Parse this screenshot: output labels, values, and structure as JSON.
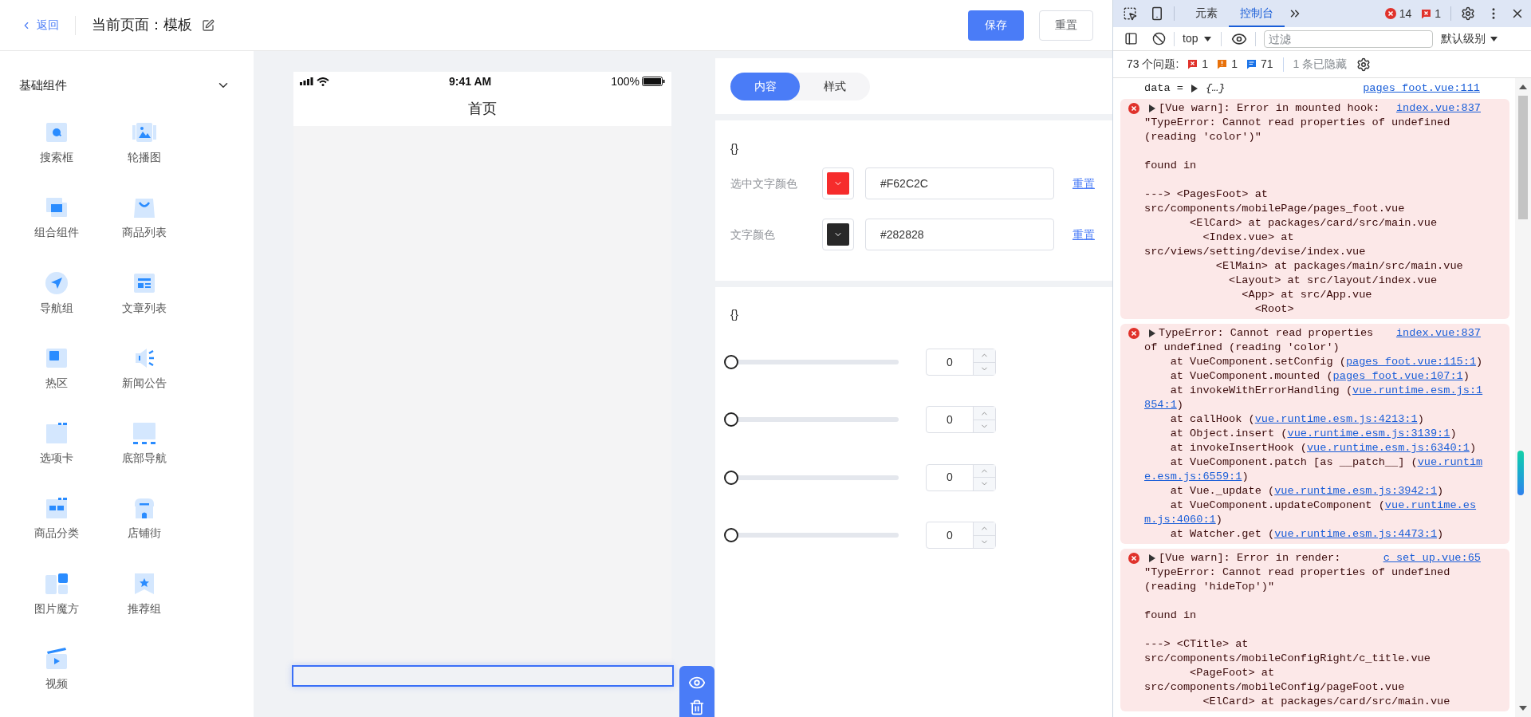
{
  "header": {
    "back": "返回",
    "title": "当前页面：模板",
    "save": "保存",
    "reset": "重置"
  },
  "sidebar": {
    "group": "基础组件",
    "expanded": true,
    "items": [
      "搜索框",
      "轮播图",
      "组合组件",
      "商品列表",
      "导航组",
      "文章列表",
      "热区",
      "新闻公告",
      "选项卡",
      "底部导航",
      "商品分类",
      "店铺街",
      "图片魔方",
      "推荐组",
      "视频"
    ]
  },
  "phone": {
    "time": "9:41 AM",
    "battery": "100%",
    "title": "首页"
  },
  "settings": {
    "tabs": [
      {
        "label": "内容",
        "selected": true
      },
      {
        "label": "样式",
        "selected": false
      }
    ],
    "color_card": {
      "title": "{}",
      "rows": [
        {
          "label": "选中文字颜色",
          "color": "#f62c2c",
          "value": "#F62C2C",
          "reset": "重置"
        },
        {
          "label": "文字颜色",
          "color": "#282828",
          "value": "#282828",
          "reset": "重置"
        }
      ]
    },
    "slider_card": {
      "title": "{}",
      "sliders": [
        {
          "level": 0,
          "value": "0"
        },
        {
          "level": 0,
          "value": "0"
        },
        {
          "level": 0,
          "value": "0"
        },
        {
          "level": 0,
          "value": "0"
        }
      ]
    }
  },
  "devtools": {
    "tabs": [
      {
        "label": "元素",
        "selected": false
      },
      {
        "label": "控制台",
        "selected": true
      }
    ],
    "error_count": "14",
    "issue_count": "1",
    "context": "top",
    "filter_placeholder": "过滤",
    "level": "默认级别",
    "issues_label": "73 个问题:",
    "issues": [
      {
        "kind": "error",
        "count": "1"
      },
      {
        "kind": "warning",
        "count": "1"
      },
      {
        "kind": "info",
        "count": "71"
      }
    ],
    "hidden": "1 条已隐藏",
    "console": [
      {
        "kind": "object",
        "name": "data =",
        "value": "{…}",
        "source": "pages_foot.vue:111"
      },
      {
        "kind": "error",
        "header": "[Vue warn]: Error in mounted hook:",
        "source": "index.vue:837",
        "paragraphs": [
          [
            {
              "text": "\"TypeError: Cannot read properties of undefined"
            },
            {
              "text": "(reading 'color')\""
            }
          ],
          [
            {
              "text": "found in"
            }
          ],
          [
            {
              "text": "---> <PagesFoot> at"
            },
            {
              "text": "src/components/mobilePage/pages_foot.vue"
            },
            {
              "text": "       <ElCard> at packages/card/src/main.vue"
            },
            {
              "text": "         <Index.vue> at"
            },
            {
              "text": "src/views/setting/devise/index.vue"
            },
            {
              "text": "           <ElMain> at packages/main/src/main.vue"
            },
            {
              "text": "             <Layout> at src/layout/index.vue"
            },
            {
              "text": "               <App> at src/App.vue"
            },
            {
              "text": "                 <Root>"
            }
          ]
        ]
      },
      {
        "kind": "error",
        "header": "TypeError: Cannot read properties",
        "source": "index.vue:837",
        "paragraphs": [
          [
            {
              "text": "of undefined (reading 'color')"
            },
            {
              "text": "    at VueComponent.setConfig (",
              "link": "pages_foot.vue:115:1",
              "after": ")"
            },
            {
              "text": "    at VueComponent.mounted (",
              "link": "pages_foot.vue:107:1",
              "after": ")"
            },
            {
              "text": "    at invokeWithErrorHandling (",
              "link": "vue.runtime.esm.js:1"
            },
            {
              "link": "854:1",
              "after": ")"
            },
            {
              "text": "    at callHook (",
              "link": "vue.runtime.esm.js:4213:1",
              "after": ")"
            },
            {
              "text": "    at Object.insert (",
              "link": "vue.runtime.esm.js:3139:1",
              "after": ")"
            },
            {
              "text": "    at invokeInsertHook (",
              "link": "vue.runtime.esm.js:6340:1",
              "after": ")"
            },
            {
              "text": "    at VueComponent.patch [as __patch__] (",
              "link": "vue.runtim"
            },
            {
              "link": "e.esm.js:6559:1",
              "after": ")"
            },
            {
              "text": "    at Vue._update (",
              "link": "vue.runtime.esm.js:3942:1",
              "after": ")"
            },
            {
              "text": "    at VueComponent.updateComponent (",
              "link": "vue.runtime.es"
            },
            {
              "link": "m.js:4060:1",
              "after": ")"
            },
            {
              "text": "    at Watcher.get (",
              "link": "vue.runtime.esm.js:4473:1",
              "after": ")"
            }
          ]
        ]
      },
      {
        "kind": "error",
        "header": "[Vue warn]: Error in render:",
        "source": "c_set_up.vue:65",
        "paragraphs": [
          [
            {
              "text": "\"TypeError: Cannot read properties of undefined"
            },
            {
              "text": "(reading 'hideTop')\""
            }
          ],
          [
            {
              "text": "found in"
            }
          ],
          [
            {
              "text": "---> <CTitle> at"
            },
            {
              "text": "src/components/mobileConfigRight/c_title.vue"
            },
            {
              "text": "       <PageFoot> at"
            },
            {
              "text": "src/components/mobileConfig/pageFoot.vue"
            },
            {
              "text": "         <ElCard> at packages/card/src/main.vue"
            }
          ]
        ]
      }
    ]
  }
}
